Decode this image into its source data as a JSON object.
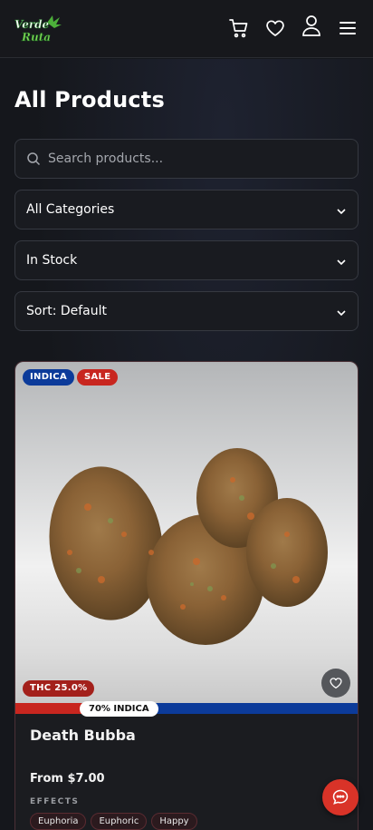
{
  "header": {
    "logo_text_line1": "Verde",
    "logo_text_line2": "Ruta",
    "icons": [
      "cart-icon",
      "heart-icon",
      "user-icon",
      "menu-icon"
    ]
  },
  "page": {
    "title": "All Products"
  },
  "filters": {
    "search_placeholder": "Search products...",
    "category_selected": "All Categories",
    "stock_selected": "In Stock",
    "sort_selected": "Sort: Default"
  },
  "product": {
    "type_badge": "INDICA",
    "sale_badge": "SALE",
    "thc_badge": "THC 25.0%",
    "strain_label": "70% INDICA",
    "indica_fraction": 0.7,
    "name": "Death Bubba",
    "price": "From $7.00",
    "effects_label": "EFFECTS",
    "effects": [
      "Euphoria",
      "Euphoric",
      "Happy"
    ]
  },
  "colors": {
    "indica": "#0c3b9a",
    "sale": "#c8261f",
    "chat": "#d93328"
  }
}
